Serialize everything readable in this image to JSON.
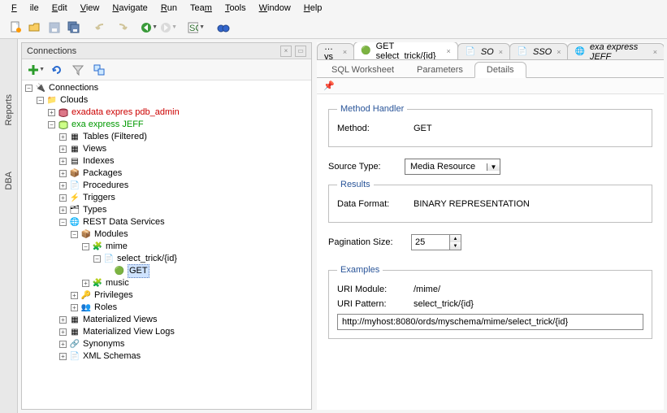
{
  "menu": {
    "items": [
      "File",
      "Edit",
      "View",
      "Navigate",
      "Run",
      "Team",
      "Tools",
      "Window",
      "Help"
    ]
  },
  "sidebar_title": "Connections",
  "vtabs": {
    "reports": "Reports",
    "dba": "DBA"
  },
  "tree": {
    "root": "Connections",
    "clouds": "Clouds",
    "conn1": "exadata expres pdb_admin",
    "conn2": "exa express JEFF",
    "nodes": {
      "tables": "Tables (Filtered)",
      "views": "Views",
      "indexes": "Indexes",
      "packages": "Packages",
      "procedures": "Procedures",
      "triggers": "Triggers",
      "types": "Types",
      "rest": "REST Data Services",
      "modules": "Modules",
      "mime": "mime",
      "select_trick": "select_trick/{id}",
      "get": "GET",
      "music": "music",
      "privileges": "Privileges",
      "roles": "Roles",
      "matviews": "Materialized Views",
      "matviewlogs": "Materialized View Logs",
      "synonyms": "Synonyms",
      "xml": "XML Schemas"
    }
  },
  "editor_tabs": {
    "overflow": "…ys",
    "t1": "GET select_trick/{id}",
    "t2": "SO",
    "t3": "SSO",
    "t4": "exa express JEFF"
  },
  "sub_tabs": {
    "ws": "SQL Worksheet",
    "params": "Parameters",
    "details": "Details"
  },
  "details": {
    "mh_legend": "Method Handler",
    "method_label": "Method:",
    "method_value": "GET",
    "src_label": "Source Type:",
    "src_value": "Media Resource",
    "results_legend": "Results",
    "df_label": "Data Format:",
    "df_value": "BINARY REPRESENTATION",
    "pg_label": "Pagination Size:",
    "pg_value": "25",
    "ex_legend": "Examples",
    "uri_mod_label": "URI Module:",
    "uri_mod_value": "/mime/",
    "uri_pat_label": "URI Pattern:",
    "uri_pat_value": "select_trick/{id}",
    "uri_full": "http://myhost:8080/ords/myschema/mime/select_trick/{id}"
  }
}
